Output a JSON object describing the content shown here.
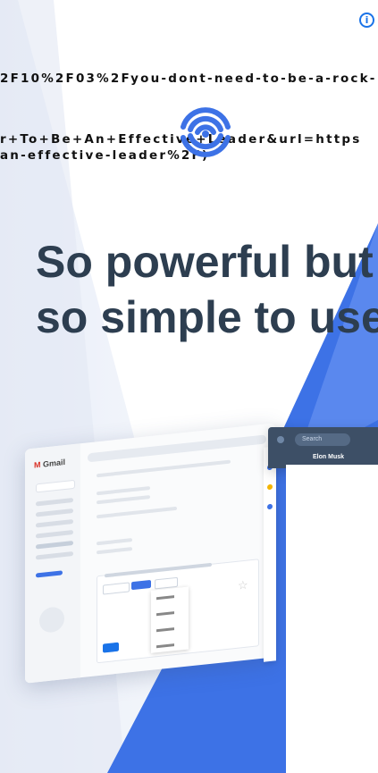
{
  "leak_text": {
    "line1": "2F10%2F03%2Fyou-dont-need-to-be-a-rock-",
    "line2": "r+To+Be+An+Effective+Leader&url=https",
    "line3": "an-effective-leader%2F)"
  },
  "ad": {
    "headline_line1": "So powerful but",
    "headline_line2": "so simple to use",
    "info_glyph": "i"
  },
  "mockup": {
    "gmail_logo": "Gmail",
    "search_placeholder": "Search",
    "contact_name": "Elon Musk"
  },
  "colors": {
    "accent_blue": "#3d72e6",
    "headline": "#2d3e50",
    "info_blue": "#1a73e8"
  }
}
